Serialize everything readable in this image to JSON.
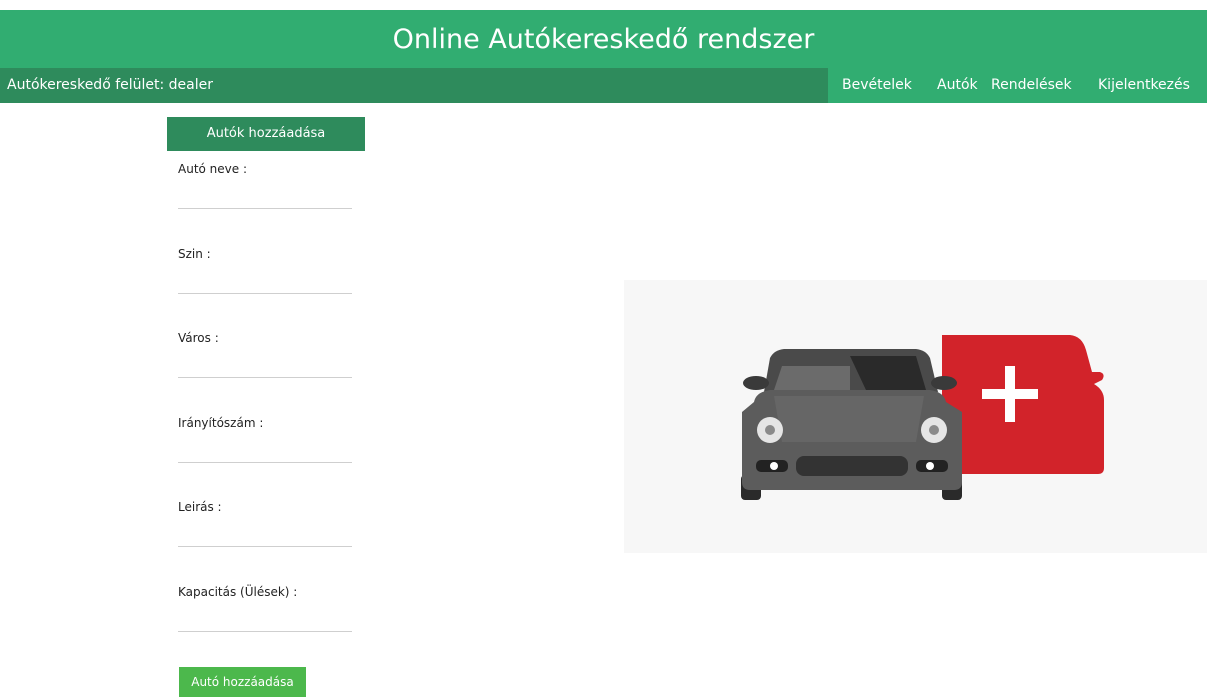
{
  "header": {
    "title": "Online Autókereskedő rendszer"
  },
  "navbar": {
    "dealer_label": "Autókereskedő felület: dealer",
    "links": [
      "Bevételek",
      "Autók",
      "Rendelések",
      "Kijelentkezés"
    ]
  },
  "form": {
    "title": "Autók hozzáadása",
    "fields": [
      {
        "label": "Autó neve :",
        "value": ""
      },
      {
        "label": "Szin :",
        "value": ""
      },
      {
        "label": "Város :",
        "value": ""
      },
      {
        "label": "Irányítószám :",
        "value": ""
      },
      {
        "label": "Leirás :",
        "value": ""
      },
      {
        "label": "Kapacitás (Ülések) :",
        "value": ""
      }
    ],
    "submit_label": "Autó hozzáadása"
  },
  "colors": {
    "header_green": "#31ad71",
    "nav_dark_green": "#2e8b5c",
    "button_green": "#4cb84c",
    "car_gray": "#5c5c5c",
    "car_red": "#d2232a"
  },
  "illustration": {
    "icon": "add-car-icon"
  }
}
